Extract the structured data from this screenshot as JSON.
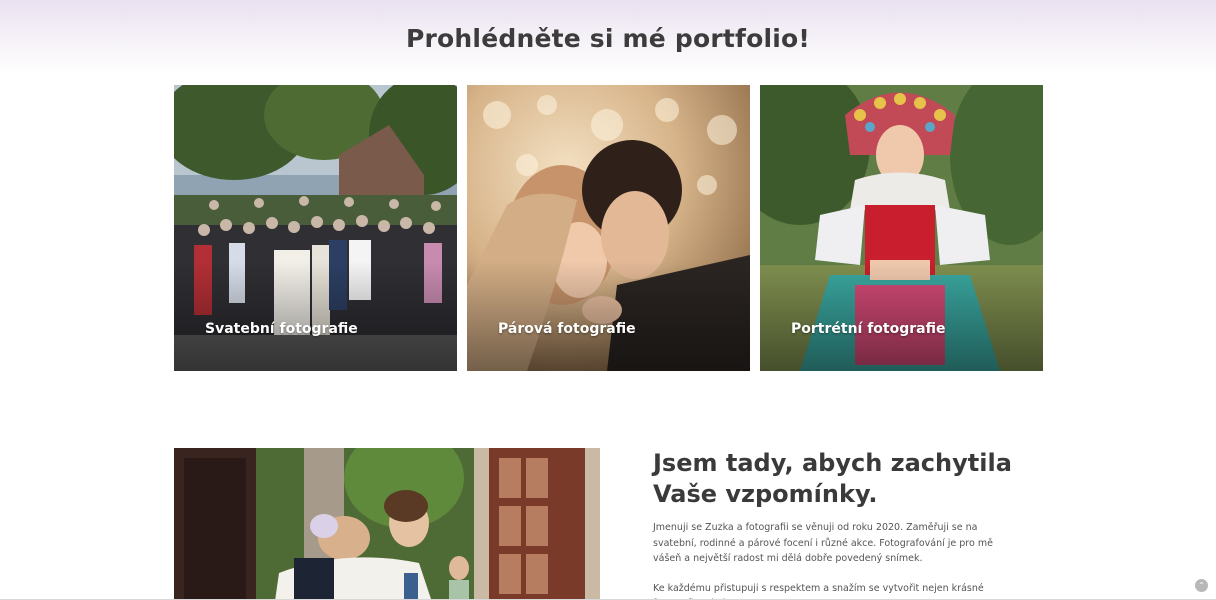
{
  "portfolio": {
    "title": "Prohlédněte si mé portfolio!",
    "cards": [
      {
        "label": "Svatební fotografie",
        "image": "wedding-group-photo"
      },
      {
        "label": "Párová fotografie",
        "image": "couple-photo"
      },
      {
        "label": "Portrétní fotografie",
        "image": "folk-costume-portrait"
      }
    ]
  },
  "about": {
    "image": "wedding-couple-photo",
    "heading_line1": "Jsem tady, abych zachytila",
    "heading_line2": "Vaše vzpomínky.",
    "paragraph1": "Jmenuji se Zuzka a fotografii se věnuji od roku 2020. Zaměřuji se na svatební, rodinné a párové focení i různé akce. Fotografování je pro mě vášeň a největší radost mi dělá dobře povedený snímek.",
    "paragraph2": "Ke každému přistupuji s respektem a snažím se vytvořit nejen krásné fotografie, ale i"
  },
  "scroll_top": {
    "icon": "chevron-up-icon",
    "glyph": "⌃"
  },
  "colors": {
    "heading": "#3c3c3c",
    "header_gradient": "#e9e1f0",
    "card_label": "#ffffff"
  }
}
